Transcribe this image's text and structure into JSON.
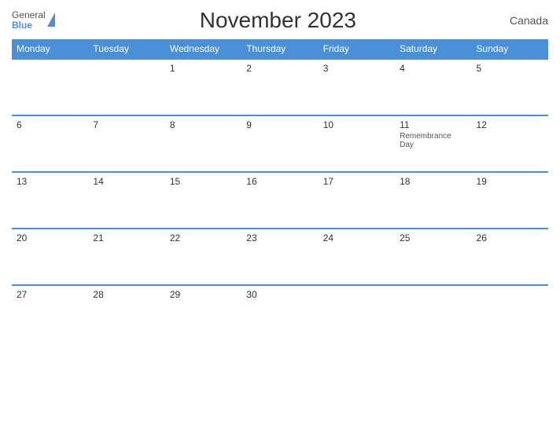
{
  "header": {
    "logo_general": "General",
    "logo_blue": "Blue",
    "title": "November 2023",
    "country": "Canada"
  },
  "weekdays": [
    "Monday",
    "Tuesday",
    "Wednesday",
    "Thursday",
    "Friday",
    "Saturday",
    "Sunday"
  ],
  "weeks": [
    [
      {
        "day": "",
        "empty": true
      },
      {
        "day": "",
        "empty": true
      },
      {
        "day": "1",
        "empty": false
      },
      {
        "day": "2",
        "empty": false
      },
      {
        "day": "3",
        "empty": false
      },
      {
        "day": "4",
        "empty": false
      },
      {
        "day": "5",
        "empty": false
      }
    ],
    [
      {
        "day": "6",
        "empty": false
      },
      {
        "day": "7",
        "empty": false
      },
      {
        "day": "8",
        "empty": false
      },
      {
        "day": "9",
        "empty": false
      },
      {
        "day": "10",
        "empty": false
      },
      {
        "day": "11",
        "empty": false,
        "holiday": "Remembrance Day"
      },
      {
        "day": "12",
        "empty": false
      }
    ],
    [
      {
        "day": "13",
        "empty": false
      },
      {
        "day": "14",
        "empty": false
      },
      {
        "day": "15",
        "empty": false
      },
      {
        "day": "16",
        "empty": false
      },
      {
        "day": "17",
        "empty": false
      },
      {
        "day": "18",
        "empty": false
      },
      {
        "day": "19",
        "empty": false
      }
    ],
    [
      {
        "day": "20",
        "empty": false
      },
      {
        "day": "21",
        "empty": false
      },
      {
        "day": "22",
        "empty": false
      },
      {
        "day": "23",
        "empty": false
      },
      {
        "day": "24",
        "empty": false
      },
      {
        "day": "25",
        "empty": false
      },
      {
        "day": "26",
        "empty": false
      }
    ],
    [
      {
        "day": "27",
        "empty": false
      },
      {
        "day": "28",
        "empty": false
      },
      {
        "day": "29",
        "empty": false
      },
      {
        "day": "30",
        "empty": false
      },
      {
        "day": "",
        "empty": true
      },
      {
        "day": "",
        "empty": true
      },
      {
        "day": "",
        "empty": true
      }
    ]
  ]
}
